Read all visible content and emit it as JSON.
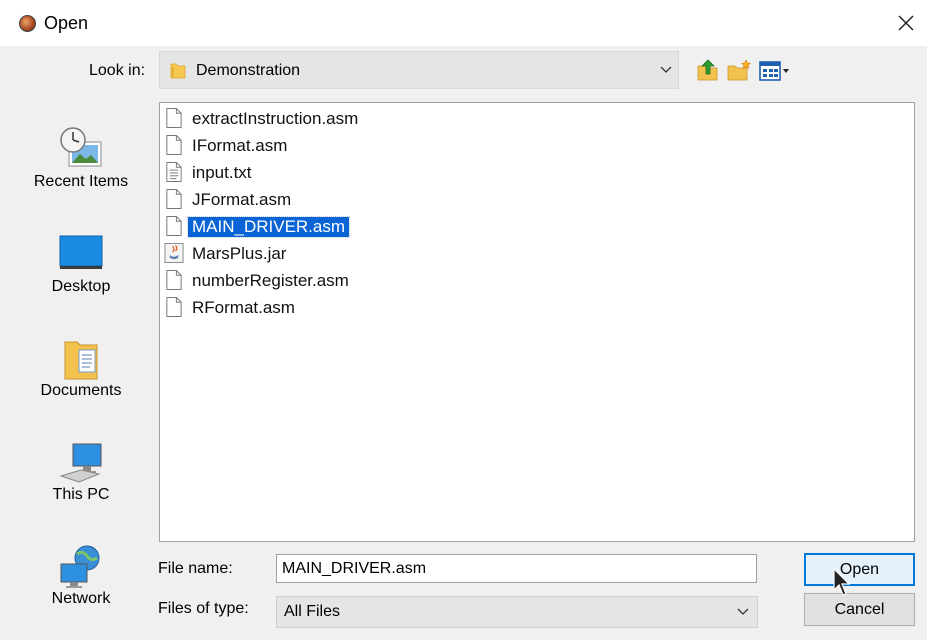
{
  "window": {
    "title": "Open"
  },
  "look_in": {
    "label": "Look in:",
    "value": "Demonstration"
  },
  "places": [
    {
      "label": "Recent Items",
      "icon": "recent-items-icon"
    },
    {
      "label": "Desktop",
      "icon": "desktop-icon"
    },
    {
      "label": "Documents",
      "icon": "documents-icon"
    },
    {
      "label": "This PC",
      "icon": "this-pc-icon"
    },
    {
      "label": "Network",
      "icon": "network-icon"
    }
  ],
  "files": [
    {
      "name": "extractInstruction.asm",
      "icon": "file-icon"
    },
    {
      "name": "IFormat.asm",
      "icon": "file-icon"
    },
    {
      "name": "input.txt",
      "icon": "text-file-icon"
    },
    {
      "name": "JFormat.asm",
      "icon": "file-icon"
    },
    {
      "name": "MAIN_DRIVER.asm",
      "icon": "file-icon",
      "selected": true
    },
    {
      "name": "MarsPlus.jar",
      "icon": "jar-file-icon"
    },
    {
      "name": "numberRegister.asm",
      "icon": "file-icon"
    },
    {
      "name": "RFormat.asm",
      "icon": "file-icon"
    }
  ],
  "file_name": {
    "label": "File name:",
    "value": "MAIN_DRIVER.asm"
  },
  "file_type": {
    "label": "Files of type:",
    "value": "All Files"
  },
  "buttons": {
    "open": "Open",
    "cancel": "Cancel"
  },
  "colors": {
    "selection": "#0a64d6",
    "default_button_border": "#0078d7",
    "dialog_bg": "#f0f0f0"
  }
}
